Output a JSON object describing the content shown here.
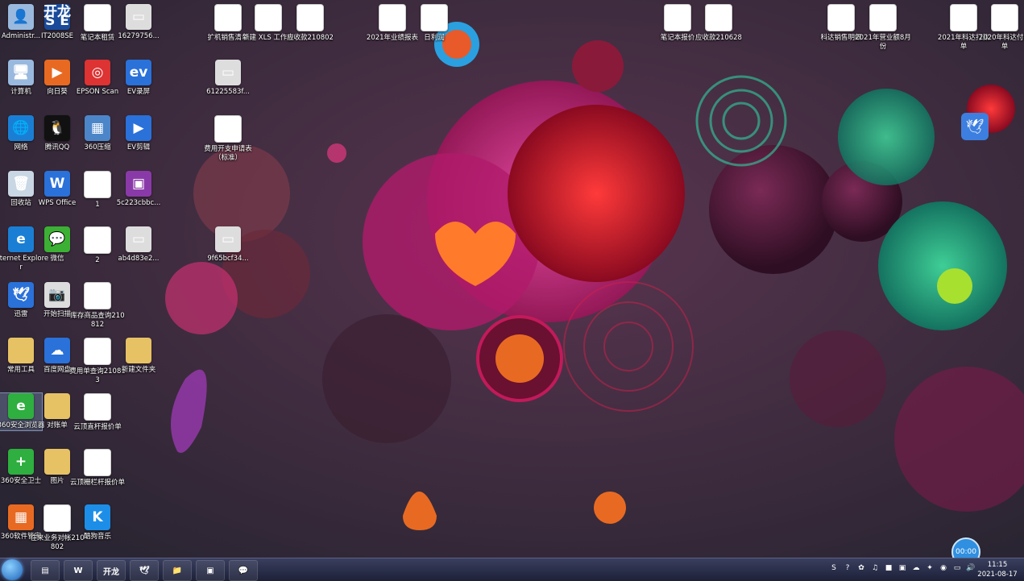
{
  "desktop_icons": [
    {
      "label": "Administr...",
      "glyph": "👤",
      "style": "g-pc"
    },
    {
      "label": "IT2008SE",
      "glyph": "开龙\nS E",
      "style": "g-it"
    },
    {
      "label": "笔记本租赁",
      "glyph": "W",
      "style": "g-wps"
    },
    {
      "label": "16279756...",
      "glyph": "▭",
      "style": "g-img"
    },
    {
      "label": "计算机",
      "glyph": "🖥",
      "style": "g-pc"
    },
    {
      "label": "向日葵",
      "glyph": "▶",
      "style": "g-orange"
    },
    {
      "label": "EPSON Scan",
      "glyph": "◎",
      "style": "g-red"
    },
    {
      "label": "EV录屏",
      "glyph": "ev",
      "style": "g-blue"
    },
    {
      "label": "网络",
      "glyph": "🌐",
      "style": "g-ie"
    },
    {
      "label": "腾讯QQ",
      "glyph": "🐧",
      "style": "g-qq"
    },
    {
      "label": "360压缩",
      "glyph": "▦",
      "style": "g-zip"
    },
    {
      "label": "EV剪辑",
      "glyph": "▶",
      "style": "g-blue"
    },
    {
      "label": "回收站",
      "glyph": "🗑",
      "style": "g-trash"
    },
    {
      "label": "WPS Office",
      "glyph": "W",
      "style": "g-blue"
    },
    {
      "label": "1",
      "glyph": "S",
      "style": "g-doc"
    },
    {
      "label": "5c223cbbc...",
      "glyph": "▣",
      "style": "g-purple"
    },
    {
      "label": "Internet Explorer",
      "glyph": "e",
      "style": "g-ie"
    },
    {
      "label": "微信",
      "glyph": "💬",
      "style": "g-wx"
    },
    {
      "label": "2",
      "glyph": "S",
      "style": "g-doc"
    },
    {
      "label": "ab4d83e2...",
      "glyph": "▭",
      "style": "g-img"
    },
    {
      "label": "迅雷",
      "glyph": "🕊",
      "style": "g-blue"
    },
    {
      "label": "开始扫描",
      "glyph": "📷",
      "style": "g-img"
    },
    {
      "label": "库存商品查询210812",
      "glyph": "S",
      "style": "g-doc"
    },
    {
      "label": "常用工具",
      "glyph": "",
      "style": "g-folder"
    },
    {
      "label": "百度网盘",
      "glyph": "☁",
      "style": "g-blue"
    },
    {
      "label": "费用单查询210813",
      "glyph": "S",
      "style": "g-doc"
    },
    {
      "label": "新建文件夹",
      "glyph": "",
      "style": "g-folder"
    },
    {
      "label": "360安全浏览器",
      "glyph": "e",
      "style": "g-green"
    },
    {
      "label": "对账单",
      "glyph": "",
      "style": "g-folder"
    },
    {
      "label": "云顶直杆报价单",
      "glyph": "S",
      "style": "g-doc"
    },
    {
      "label": "360安全卫士",
      "glyph": "+",
      "style": "g-green"
    },
    {
      "label": "图片",
      "glyph": "",
      "style": "g-folder"
    },
    {
      "label": "云顶栅栏杆报价单",
      "glyph": "S",
      "style": "g-doc"
    },
    {
      "label": "360软件管家",
      "glyph": "▦",
      "style": "g-orange"
    },
    {
      "label": "往来业务对帐210802",
      "glyph": "S",
      "style": "g-doc"
    },
    {
      "label": "酷狗音乐",
      "glyph": "K",
      "style": "g-kugou"
    },
    {
      "label": "扩机销售清单",
      "glyph": "S",
      "style": "g-doc"
    },
    {
      "label": "新建 XLS 工作表",
      "glyph": "S",
      "style": "g-doc"
    },
    {
      "label": "应收款210802",
      "glyph": "S",
      "style": "g-doc"
    },
    {
      "label": "61225583f...",
      "glyph": "▭",
      "style": "g-img"
    },
    {
      "label": "费用开支申请表（标准）",
      "glyph": "S",
      "style": "g-doc"
    },
    {
      "label": "9f65bcf34...",
      "glyph": "▭",
      "style": "g-img"
    },
    {
      "label": "2021年业绩报表",
      "glyph": "S",
      "style": "g-doc"
    },
    {
      "label": "日利润",
      "glyph": "S",
      "style": "g-doc"
    },
    {
      "label": "笔记本报价",
      "glyph": "S",
      "style": "g-doc"
    },
    {
      "label": "应收款210628",
      "glyph": "S",
      "style": "g-doc"
    },
    {
      "label": "科达销售明细",
      "glyph": "S",
      "style": "g-doc"
    },
    {
      "label": "2021年营业额8月份",
      "glyph": "S",
      "style": "g-doc"
    },
    {
      "label": "2021年科达打款单",
      "glyph": "S",
      "style": "g-doc"
    },
    {
      "label": "2020年科达付款单",
      "glyph": "S",
      "style": "g-doc"
    }
  ],
  "taskbar": {
    "apps": [
      {
        "name": "file-manager",
        "glyph": "▤"
      },
      {
        "name": "wps",
        "glyph": "W"
      },
      {
        "name": "it2008se",
        "glyph": "开龙"
      },
      {
        "name": "xunlei",
        "glyph": "🕊"
      },
      {
        "name": "explorer",
        "glyph": "📁"
      },
      {
        "name": "remote",
        "glyph": "▣"
      },
      {
        "name": "wechat",
        "glyph": "💬"
      }
    ],
    "time": "11:15",
    "date": "2021-08-17"
  },
  "recorder_timer": "00:00",
  "tray_icons": [
    "S",
    "?",
    "✿",
    "♫",
    "■",
    "▣",
    "☁",
    "✦",
    "◉",
    "▭",
    "🔊"
  ]
}
